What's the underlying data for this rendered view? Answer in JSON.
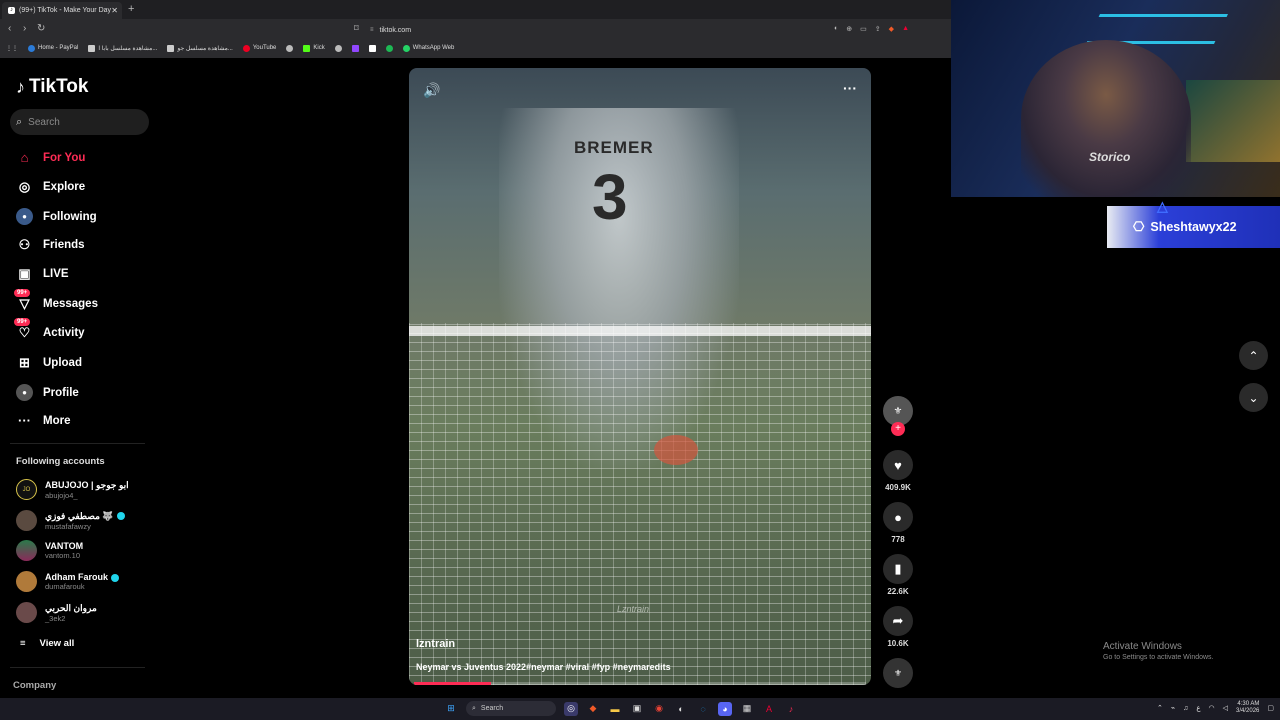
{
  "browser": {
    "tab_title": "(99+) TikTok - Make Your Day",
    "url": "tiktok.com",
    "bookmarks": [
      "Home - PayPal",
      "مشاهدة مسلسل بابا ا...",
      "مشاهدة مسلسل جو...",
      "YouTube",
      "Kick",
      "WhatsApp Web"
    ]
  },
  "sidebar": {
    "logo": "TikTok",
    "search_placeholder": "Search",
    "nav": [
      {
        "label": "For You",
        "icon": "home-icon"
      },
      {
        "label": "Explore",
        "icon": "compass-icon"
      },
      {
        "label": "Following",
        "icon": "following-icon"
      },
      {
        "label": "Friends",
        "icon": "friends-icon"
      },
      {
        "label": "LIVE",
        "icon": "live-icon"
      },
      {
        "label": "Messages",
        "icon": "messages-icon",
        "badge": "99+"
      },
      {
        "label": "Activity",
        "icon": "activity-icon",
        "badge": "99+"
      },
      {
        "label": "Upload",
        "icon": "upload-icon"
      },
      {
        "label": "Profile",
        "icon": "profile-icon"
      },
      {
        "label": "More",
        "icon": "more-icon"
      }
    ],
    "following_title": "Following accounts",
    "accounts": [
      {
        "name": "ABUJOJO | ابو جوجو",
        "handle": "abujojo4_",
        "avatar": "JO"
      },
      {
        "name": "مصطفي فوزي 🐺",
        "handle": "mustafafawzy",
        "avatar": "",
        "verified": true
      },
      {
        "name": "VANTOM",
        "handle": "vantom.10",
        "avatar": ""
      },
      {
        "name": "Adham Farouk",
        "handle": "dumafarouk",
        "avatar": "",
        "verified": true
      },
      {
        "name": "مروان الحربي",
        "handle": "_3ek2",
        "avatar": ""
      }
    ],
    "view_all": "View all",
    "company": "Company"
  },
  "video": {
    "jersey_name": "BREMER",
    "jersey_number": "3",
    "watermark": "Lzntrain",
    "author": "lzntrain",
    "caption": "Neymar vs Juventus 2022#neymar #viral #fyp #neymaredits",
    "progress": 0.17
  },
  "actions": {
    "likes": "409.9K",
    "comments": "778",
    "saves": "22.6K",
    "shares": "10.6K"
  },
  "stream": {
    "psn_name": "Sheshtawyx22",
    "hoodie_text": "Storico"
  },
  "windows": {
    "activate_title": "Activate Windows",
    "activate_sub": "Go to Settings to activate Windows.",
    "taskbar_search": "Search",
    "time": "4:30 AM",
    "date": "3/4/2026"
  }
}
